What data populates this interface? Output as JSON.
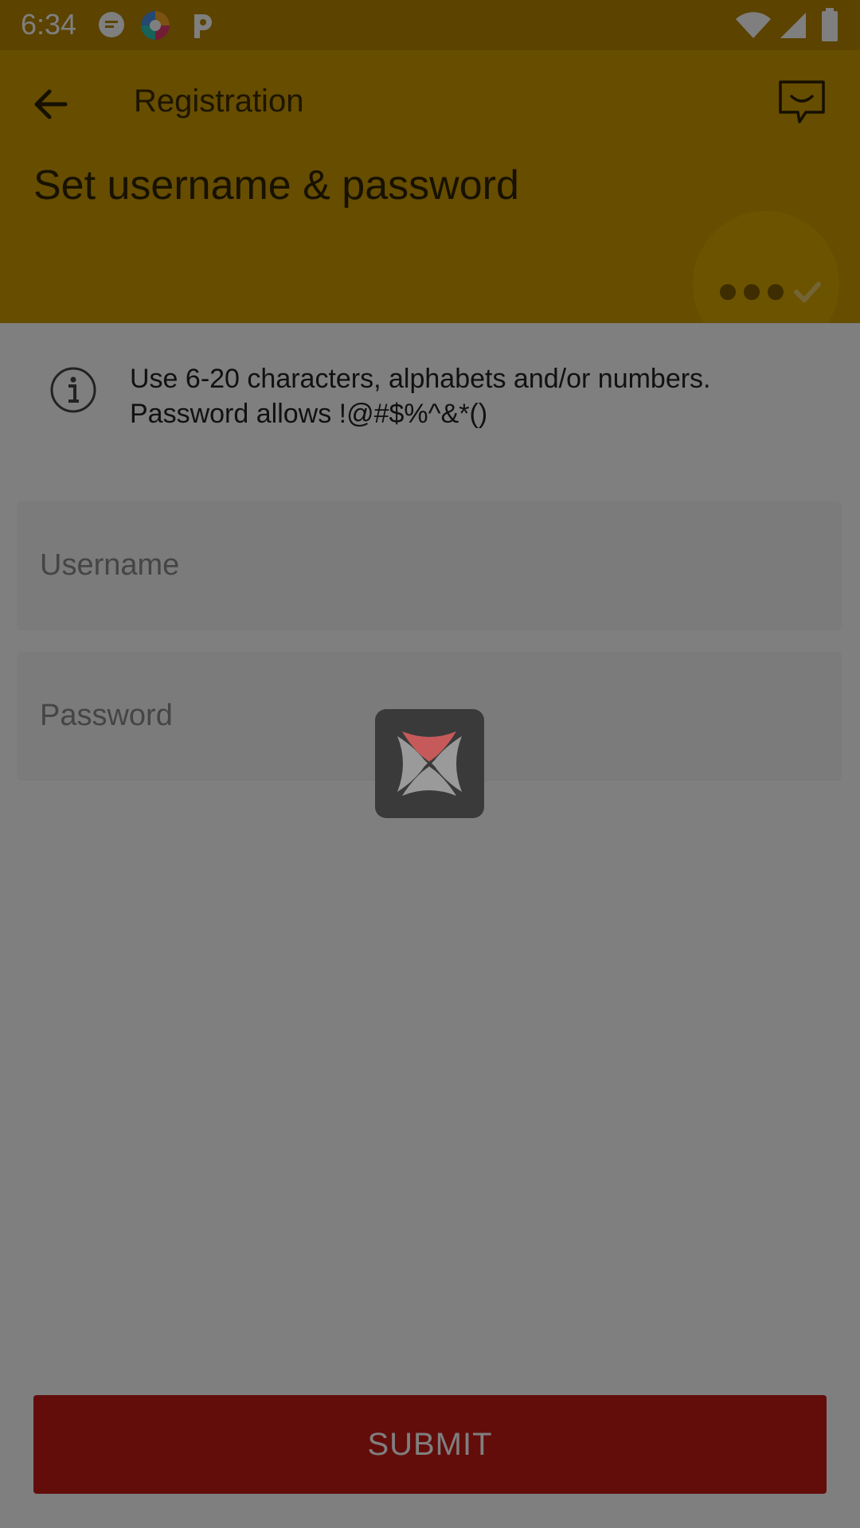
{
  "status_bar": {
    "time": "6:34",
    "icons": [
      "message-icon",
      "browser-icon",
      "p-app-icon",
      "wifi-icon",
      "signal-icon",
      "battery-icon"
    ]
  },
  "header": {
    "title": "Registration",
    "page_title": "Set username & password",
    "color": "#cc9a00"
  },
  "info": {
    "line1": "Use 6-20 characters, alphabets and/or numbers.",
    "line2": "Password allows !@#$%^&*()"
  },
  "form": {
    "username_placeholder": "Username",
    "username_value": "",
    "password_placeholder": "Password",
    "password_value": ""
  },
  "submit": {
    "label": "SUBMIT",
    "color": "#c41a15"
  },
  "overlay": {
    "loading": true,
    "loader_icon": "loading-logo-icon"
  }
}
